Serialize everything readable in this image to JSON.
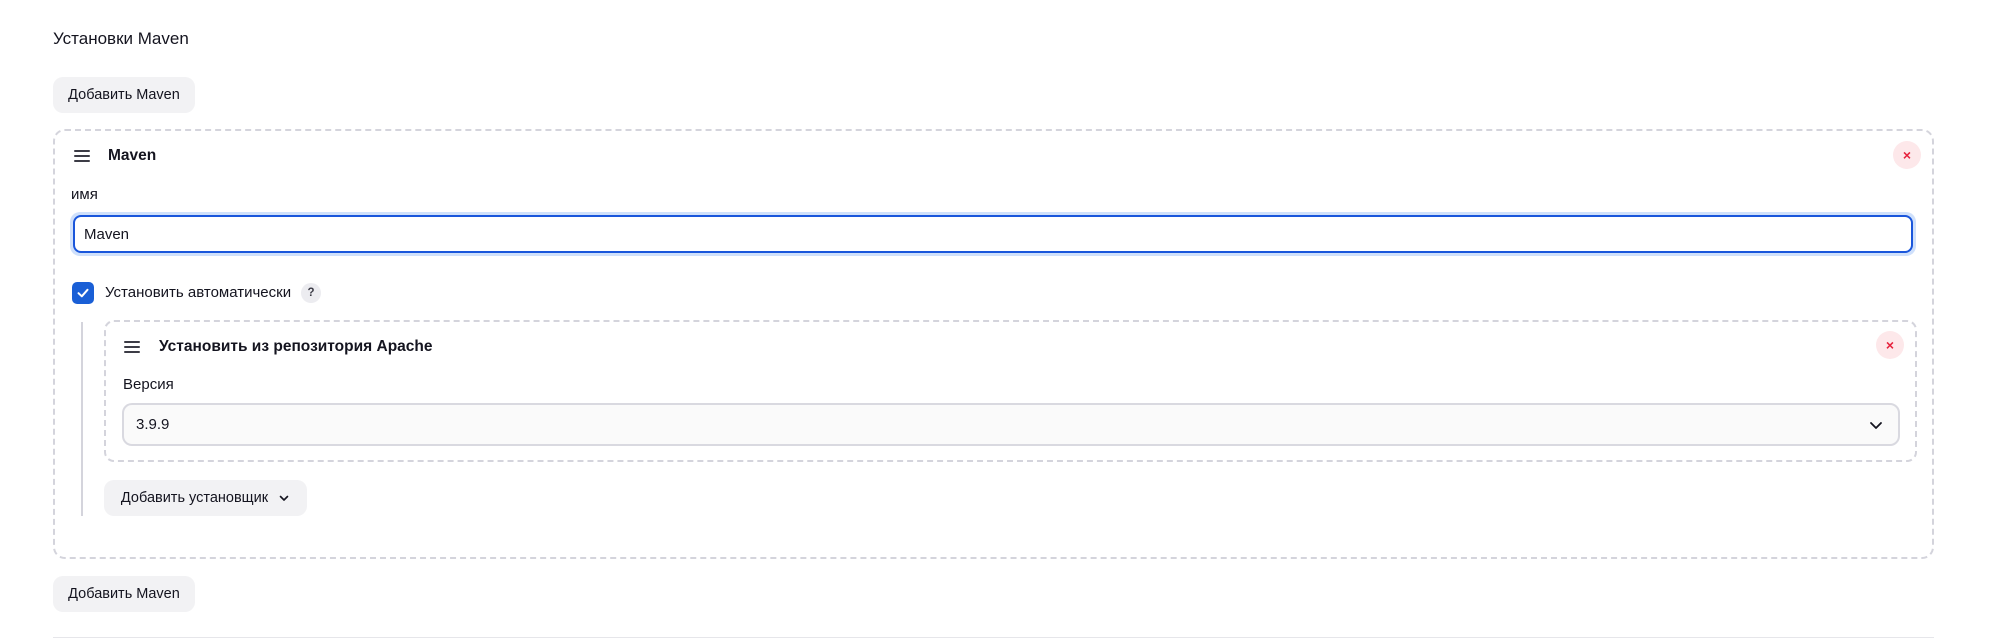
{
  "section": {
    "title": "Установки Maven",
    "add_button_label": "Добавить Maven"
  },
  "maven_entry": {
    "title": "Maven",
    "close_icon": "×",
    "name_label": "имя",
    "name_value": "Maven",
    "auto_install_label": "Установить автоматически",
    "auto_install_checked": true,
    "help_icon": "?",
    "installer": {
      "title": "Установить из репозитория Apache",
      "close_icon": "×",
      "version_label": "Версия",
      "version_value": "3.9.9"
    },
    "add_installer_label": "Добавить установщик"
  },
  "colors": {
    "accent": "#1a5fd6",
    "danger": "#e6223d",
    "danger_bg": "#fde8ea",
    "button_bg": "#f2f2f4",
    "dashed_border": "#d4d4dc"
  },
  "icons": {
    "drag": "drag-handle-icon",
    "close": "close-icon",
    "check": "checkmark-icon",
    "help": "help-icon",
    "chevron": "chevron-down-icon"
  }
}
